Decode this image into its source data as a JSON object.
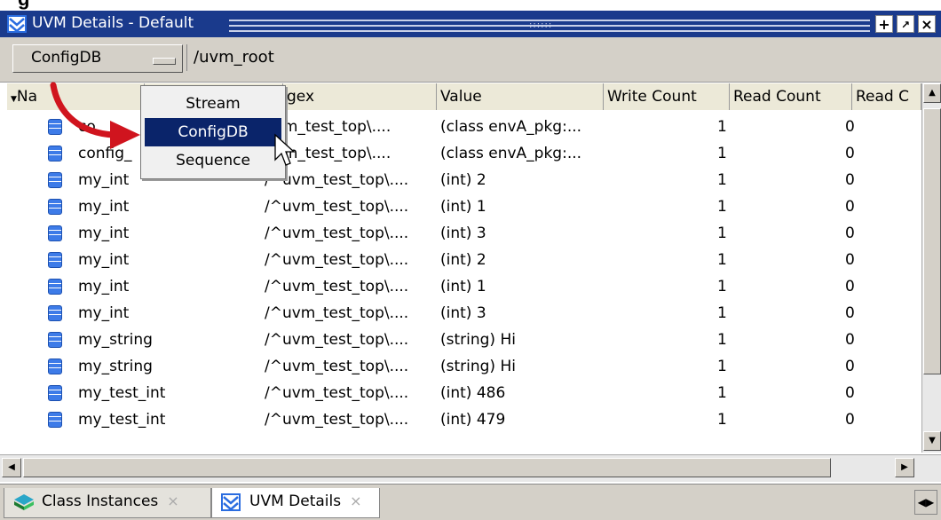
{
  "window": {
    "title": "UVM Details - Default"
  },
  "toolbar": {
    "mode_value": "ConfigDB",
    "path": "/uvm_root"
  },
  "menu": {
    "options": [
      {
        "label": "Stream",
        "selected": false
      },
      {
        "label": "ConfigDB",
        "selected": true
      },
      {
        "label": "Sequence",
        "selected": false
      }
    ]
  },
  "table": {
    "columns": [
      "Name",
      "Regex",
      "Value",
      "Write Count",
      "Read Count",
      "Read C"
    ],
    "header_visible": {
      "name": "Na",
      "regex": "gex"
    },
    "rows": [
      {
        "name": "co",
        "regex": "uvm_test_top\\....",
        "value": "(class envA_pkg:...",
        "write": "1",
        "read": "0"
      },
      {
        "name": "config_",
        "regex": "uvm_test_top\\....",
        "value": "(class envA_pkg:...",
        "write": "1",
        "read": "0"
      },
      {
        "name": "my_int",
        "regex": "/^uvm_test_top\\....",
        "value": "(int) 2",
        "write": "1",
        "read": "0"
      },
      {
        "name": "my_int",
        "regex": "/^uvm_test_top\\....",
        "value": "(int) 1",
        "write": "1",
        "read": "0"
      },
      {
        "name": "my_int",
        "regex": "/^uvm_test_top\\....",
        "value": "(int) 3",
        "write": "1",
        "read": "0"
      },
      {
        "name": "my_int",
        "regex": "/^uvm_test_top\\....",
        "value": "(int) 2",
        "write": "1",
        "read": "0"
      },
      {
        "name": "my_int",
        "regex": "/^uvm_test_top\\....",
        "value": "(int) 1",
        "write": "1",
        "read": "0"
      },
      {
        "name": "my_int",
        "regex": "/^uvm_test_top\\....",
        "value": "(int) 3",
        "write": "1",
        "read": "0"
      },
      {
        "name": "my_string",
        "regex": "/^uvm_test_top\\....",
        "value": "(string) Hi",
        "write": "1",
        "read": "0"
      },
      {
        "name": "my_string",
        "regex": "/^uvm_test_top\\....",
        "value": "(string) Hi",
        "write": "1",
        "read": "0"
      },
      {
        "name": "my_test_int",
        "regex": "/^uvm_test_top\\....",
        "value": "(int) 486",
        "write": "1",
        "read": "0"
      },
      {
        "name": "my_test_int",
        "regex": "/^uvm_test_top\\....",
        "value": "(int) 479",
        "write": "1",
        "read": "0"
      }
    ]
  },
  "tabs": [
    {
      "label": "Class Instances",
      "close": "×",
      "icon": "class-instances-icon"
    },
    {
      "label": "UVM Details",
      "close": "×",
      "icon": "uvm-details-icon"
    }
  ],
  "colors": {
    "titlebar": "#1a3a8c",
    "menu_selected": "#0a246a",
    "arrow": "#d0141e",
    "db_icon": "#3d7be8"
  }
}
